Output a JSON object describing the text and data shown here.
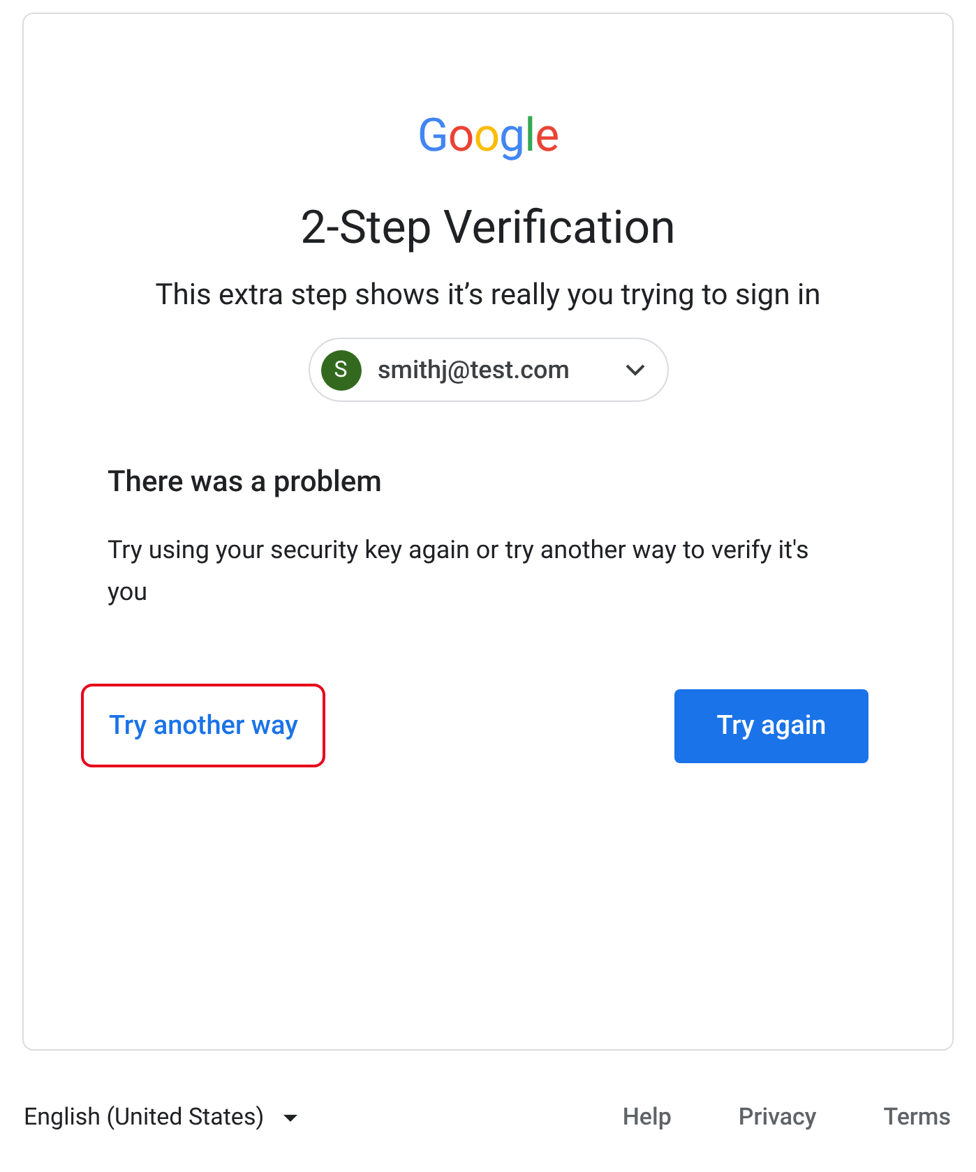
{
  "logo": {
    "letters": [
      {
        "text": "G",
        "color": "#4285f4"
      },
      {
        "text": "o",
        "color": "#ea4335"
      },
      {
        "text": "o",
        "color": "#fbbc05"
      },
      {
        "text": "g",
        "color": "#4285f4"
      },
      {
        "text": "l",
        "color": "#34a853"
      },
      {
        "text": "e",
        "color": "#ea4335"
      }
    ]
  },
  "title": "2-Step Verification",
  "subtitle": "This extra step shows it’s really you trying to sign in",
  "account": {
    "initial": "S",
    "email": "smithj@test.com"
  },
  "error": {
    "heading": "There was a problem",
    "message": "Try using your security key again or try another way to verify it's you"
  },
  "actions": {
    "link": {
      "label": "Try another way",
      "highlighted": true
    },
    "button": {
      "label": "Try again"
    }
  },
  "footer": {
    "language": "English (United States)",
    "links": [
      "Help",
      "Privacy",
      "Terms"
    ]
  }
}
